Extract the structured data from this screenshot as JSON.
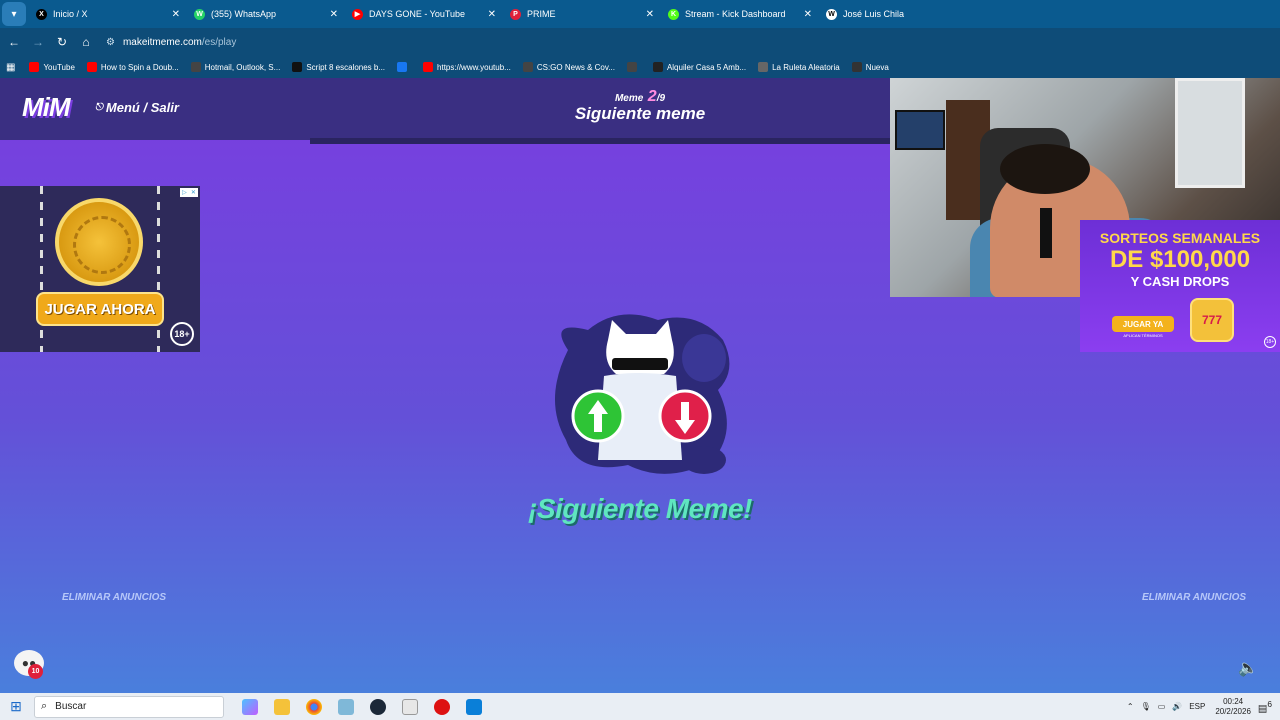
{
  "browser": {
    "tabs": [
      {
        "title": "Inicio / X",
        "fav": "X",
        "color": "#000000"
      },
      {
        "title": "(355) WhatsApp",
        "fav": "W",
        "color": "#25d366"
      },
      {
        "title": "DAYS GONE - YouTube",
        "fav": "▶",
        "color": "#ff0000"
      },
      {
        "title": "PRIME",
        "fav": "P",
        "color": "#e0203a"
      },
      {
        "title": "Stream - Kick Dashboard",
        "fav": "K",
        "color": "#53fc18"
      },
      {
        "title": "José Luis Chila",
        "fav": "W",
        "color": "#ffffff"
      }
    ],
    "url_host": "makeitmeme.com",
    "url_path": "/es/play",
    "bookmarks": [
      {
        "label": "YouTube",
        "color": "#ff0000"
      },
      {
        "label": "How to Spin a Doub...",
        "color": "#ff0000"
      },
      {
        "label": "Hotmail, Outlook, S...",
        "color": "#444444"
      },
      {
        "label": "Script 8 escalones b...",
        "color": "#111111"
      },
      {
        "label": "",
        "color": "#1877f2"
      },
      {
        "label": "https://www.youtub...",
        "color": "#ff0000"
      },
      {
        "label": "CS:GO News & Cov...",
        "color": "#444444"
      },
      {
        "label": "",
        "color": "#444444"
      },
      {
        "label": "Alquiler Casa 5 Amb...",
        "color": "#222222"
      },
      {
        "label": "La Ruleta Aleatoria",
        "color": "#666666"
      },
      {
        "label": "Nueva",
        "color": "#333333"
      }
    ]
  },
  "site": {
    "logo": "MiM",
    "menu_label": "Menú / Salir",
    "meme_word": "Meme",
    "meme_current": "2",
    "meme_total": "/9",
    "header_title": "Siguiente meme",
    "cta": "¡Siguiente Meme!",
    "remove_ads": "ELIMINAR ANUNCIOS",
    "chat_count": "10"
  },
  "ads": {
    "left_button": "JUGAR AHORA",
    "left_age": "18+",
    "right_line1": "SORTEOS SEMANALES",
    "right_line2": "DE $100,000",
    "right_line3": "Y CASH DROPS",
    "right_button": "JUGAR YA",
    "right_terms": "APLICAN TÉRMINOS",
    "right_age": "18+"
  },
  "taskbar": {
    "search_placeholder": "Buscar",
    "lang": "ESP",
    "time": "00:24",
    "date": "20/2/2026",
    "notif_count": "6"
  }
}
